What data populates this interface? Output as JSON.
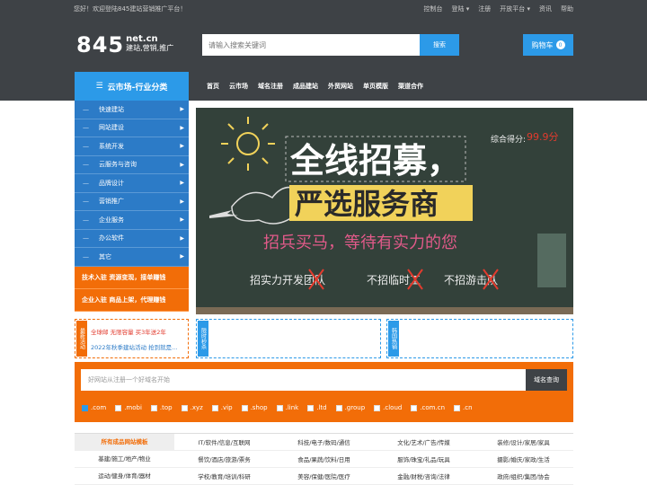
{
  "topbar": {
    "welcome": "您好！欢迎登陆845建站营销推广平台！",
    "links": [
      "控制台",
      "登陆 ▾",
      "注册",
      "开放平台 ▾",
      "资讯",
      "帮助"
    ]
  },
  "header": {
    "logo_big": "845",
    "logo_domain": "net.cn",
    "logo_slogan": "建站,营销,推广",
    "search_placeholder": "请输入搜索关键词",
    "search_button": "搜索",
    "cart_label": "购物车",
    "cart_count": "0"
  },
  "nav": {
    "category_title": "云市场-行业分类",
    "category_icon": "menu-icon",
    "items": [
      "首页",
      "云市场",
      "域名注册",
      "成品建站",
      "外贸网站",
      "单页模版",
      "渠道合作"
    ]
  },
  "sidebar": {
    "items": [
      "快速建站",
      "网站建设",
      "系统开发",
      "云服务与咨询",
      "品牌设计",
      "营销推广",
      "企业服务",
      "办公软件",
      "其它"
    ],
    "promo": [
      "技术入驻  资源变现，接单赚钱",
      "企业入驻  商品上架，代理赚钱"
    ]
  },
  "banner": {
    "title1": "全线招募，",
    "title2": "严选服务商",
    "subtitle": "招兵买马，等待有实力的您",
    "score": "综合得分:",
    "score_value": "99.9分",
    "tag1": "招实力开发团队",
    "tag2": "不招临时工",
    "tag3": "不招游击队"
  },
  "news": {
    "box1_tag": "最新活动",
    "box1_lines": [
      "全球邮 无限容量 买3年送2年",
      "2022年秋季建站活动 抢到就是..."
    ],
    "box2_tag": "限时秒杀",
    "box3_tag": "韩国热销"
  },
  "domain": {
    "placeholder": "好网站从注册一个好域名开始",
    "button": "域名查询",
    "tlds": [
      ".com",
      ".mobi",
      ".top",
      ".xyz",
      ".vip",
      ".shop",
      ".link",
      ".ltd",
      ".group",
      ".cloud",
      ".com.cn",
      ".cn"
    ]
  },
  "categories": [
    [
      "所有成品网站模板",
      "IT/软件/信息/互联网",
      "科技/电子/数码/通信",
      "文化/艺术/广告/传媒",
      "装修/设计/家居/家具"
    ],
    [
      "基建/施工/地产/物业",
      "餐饮/酒店/旅游/票务",
      "食品/果蔬/饮料/日用",
      "服饰/珠宝/礼品/玩具",
      "摄影/婚庆/家政/生活"
    ],
    [
      "运动/健身/体育/器材",
      "学校/教育/培训/科研",
      "美容/保健/医院/医疗",
      "金融/财税/咨询/法律",
      "政府/组织/集团/协会"
    ]
  ]
}
